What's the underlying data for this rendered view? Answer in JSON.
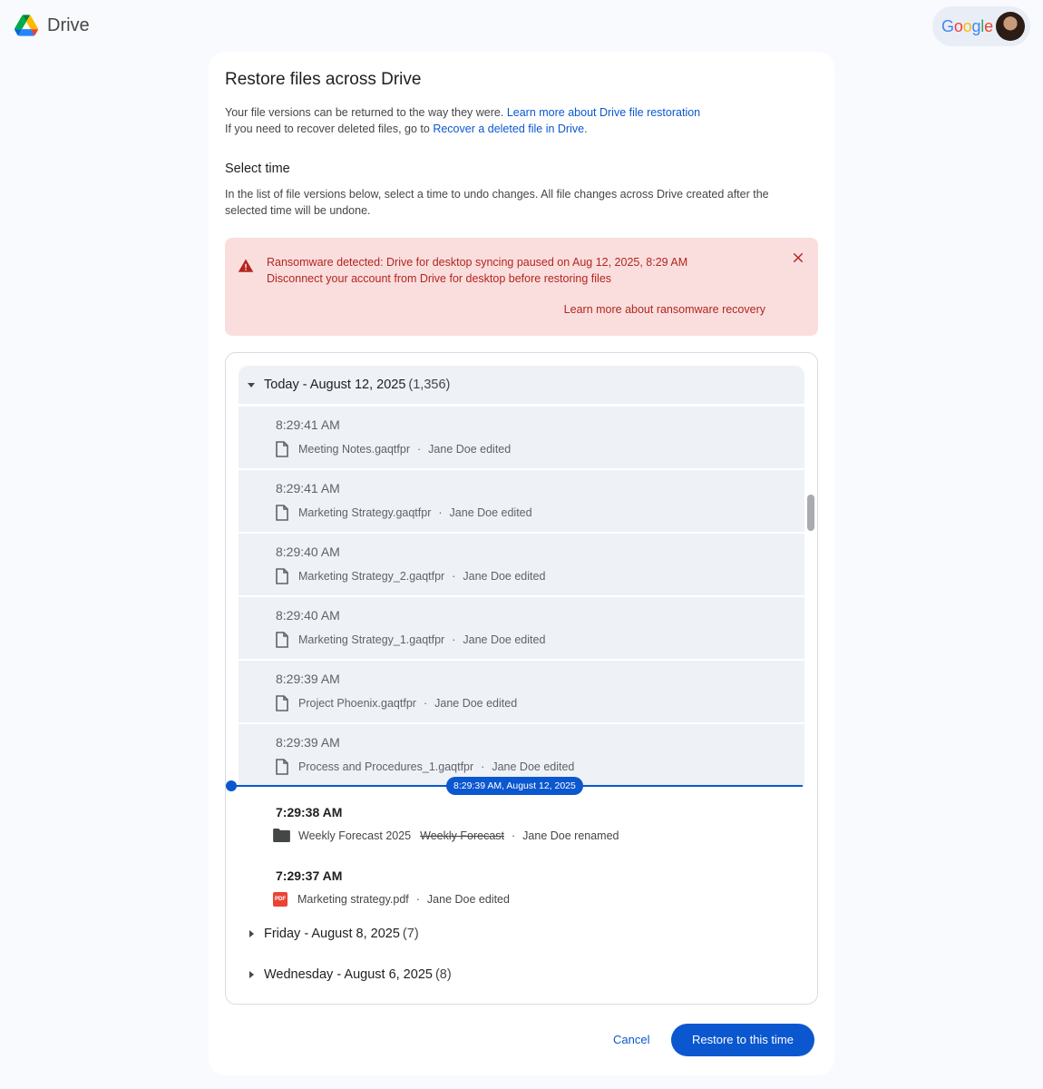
{
  "app": {
    "name": "Drive",
    "account_brand": "Google"
  },
  "dialog": {
    "title": "Restore files across Drive",
    "intro_line1": "Your file versions can be returned to the way they were. ",
    "intro_link1": "Learn more about Drive file restoration",
    "intro_line2": "If you need to recover deleted files, go to ",
    "intro_link2": "Recover a deleted file in Drive",
    "intro_line2_end": ".",
    "section_title": "Select time",
    "section_desc": "In the list of file versions below, select a time to undo changes. All file changes across Drive created after the selected time will be undone."
  },
  "alert": {
    "title": "Ransomware detected: Drive for desktop syncing paused on Aug 12, 2025, 8:29 AM",
    "subtitle": "Disconnect your account from Drive for desktop before restoring files",
    "link": "Learn more about ransomware recovery",
    "color": "#b3261e",
    "background": "#fadede"
  },
  "groups": [
    {
      "label": "Today - August 12, 2025",
      "count": "(1,356)",
      "expanded": true
    },
    {
      "label": "Friday - August 8, 2025",
      "count": "(7)",
      "expanded": false
    },
    {
      "label": "Wednesday - August 6, 2025",
      "count": "(8)",
      "expanded": false
    }
  ],
  "entries_before": [
    {
      "time": "8:29:41 AM",
      "file": "Meeting Notes.gaqtfpr",
      "action": "Jane Doe edited",
      "icon": "document-icon"
    },
    {
      "time": "8:29:41 AM",
      "file": "Marketing Strategy.gaqtfpr",
      "action": "Jane Doe edited",
      "icon": "document-icon"
    },
    {
      "time": "8:29:40 AM",
      "file": "Marketing Strategy_2.gaqtfpr",
      "action": "Jane Doe edited",
      "icon": "document-icon"
    },
    {
      "time": "8:29:40 AM",
      "file": "Marketing Strategy_1.gaqtfpr",
      "action": "Jane Doe edited",
      "icon": "document-icon"
    },
    {
      "time": "8:29:39 AM",
      "file": "Project Phoenix.gaqtfpr",
      "action": "Jane Doe edited",
      "icon": "document-icon"
    },
    {
      "time": "8:29:39 AM",
      "file": "Process and Procedures_1.gaqtfpr",
      "action": "Jane Doe edited",
      "icon": "document-icon"
    }
  ],
  "timeline_marker": "8:29:39 AM, August 12, 2025",
  "entries_after": [
    {
      "time": "7:29:38 AM",
      "file": "Weekly Forecast 2025",
      "old_name": "Weekly Forecast",
      "action": "Jane Doe renamed",
      "icon": "folder-icon"
    },
    {
      "time": "7:29:37 AM",
      "file": "Marketing strategy.pdf",
      "action": "Jane Doe edited",
      "icon": "pdf-icon",
      "icon_text": "PDF"
    }
  ],
  "buttons": {
    "cancel": "Cancel",
    "restore": "Restore to this time"
  },
  "colors": {
    "accent": "#0b57d0",
    "selected_bg": "#eef1f6"
  }
}
